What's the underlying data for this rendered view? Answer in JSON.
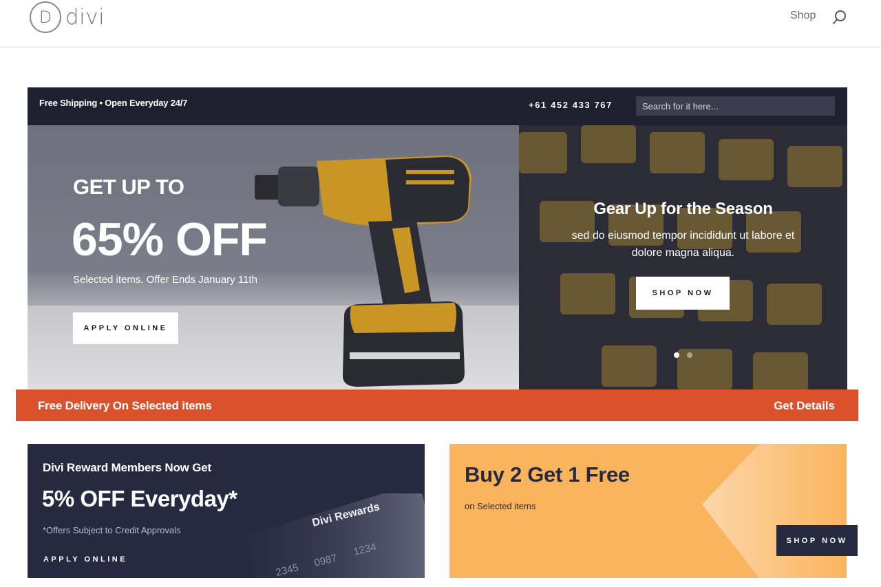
{
  "header": {
    "logo_letter": "D",
    "logo_text": "divi",
    "nav_shop": "Shop",
    "search_icon": "search-icon"
  },
  "topbar": {
    "info": "Free Shipping • Open Everyday 24/7",
    "phone": "+61 452 433 767",
    "search_placeholder": "Search for it here..."
  },
  "hero_left": {
    "title_small": "GET UP TO",
    "title_big": "65% OFF",
    "subtitle": "Selected items. Offer Ends January 11th",
    "button": "APPLY ONLINE"
  },
  "hero_right": {
    "title": "Gear Up for the Season",
    "description": "sed do eiusmod tempor incididunt ut labore et dolore magna aliqua.",
    "button": "SHOP NOW",
    "slides": 2,
    "active_slide": 1
  },
  "delivery_bar": {
    "text": "Free Delivery On Selected items",
    "link": "Get Details",
    "color": "#d9522c"
  },
  "reward": {
    "line1": "Divi Reward Members Now Get",
    "line2": "5% OFF Everyday*",
    "note": "*Offers Subject to Credit Approvals",
    "button": "APPLY ONLINE",
    "card_label": "Divi Rewards",
    "card_numbers": [
      "2345",
      "0987",
      "1234"
    ]
  },
  "promo": {
    "title": "Buy 2 Get 1 Free",
    "subtitle": "on Selected items",
    "button": "SHOP NOW",
    "color": "#fbb45e"
  }
}
